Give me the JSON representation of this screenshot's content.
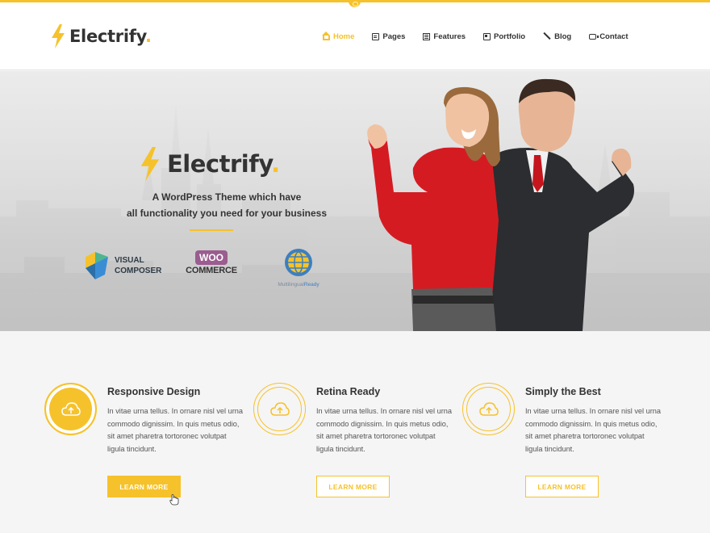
{
  "brand": {
    "name": "Electrify",
    "dot": ".",
    "accent_color": "#f6c22b"
  },
  "nav": {
    "items": [
      {
        "label": "Home",
        "icon": "home-icon",
        "active": true
      },
      {
        "label": "Pages",
        "icon": "pages-icon"
      },
      {
        "label": "Features",
        "icon": "features-icon"
      },
      {
        "label": "Portfolio",
        "icon": "portfolio-icon"
      },
      {
        "label": "Blog",
        "icon": "blog-icon"
      },
      {
        "label": "Contact",
        "icon": "contact-icon"
      }
    ]
  },
  "hero": {
    "logo_text": "Electrify",
    "logo_dot": ".",
    "tagline_line1": "A WordPress Theme which have",
    "tagline_line2": "all functionality you need for your business",
    "partners": {
      "vc_line1": "VISUAL",
      "vc_line2": "COMPOSER",
      "woo_badge": "WOO",
      "woo_text": "COMMERCE",
      "wpml_text": "Multilingual",
      "wpml_ready": "Ready"
    }
  },
  "features": [
    {
      "title": "Responsive Design",
      "text": "In vitae urna tellus. In ornare nisl vel urna commodo dignissim. In quis metus odio, sit amet pharetra tortoronec volutpat ligula tincidunt.",
      "button": "LEARN MORE",
      "icon": "cloud-upload-icon"
    },
    {
      "title": "Retina Ready",
      "text": "In vitae urna tellus. In ornare nisl vel urna commodo dignissim. In quis metus odio, sit amet pharetra tortoronec volutpat ligula tincidunt.",
      "button": "LEARN MORE",
      "icon": "cloud-upload-icon"
    },
    {
      "title": "Simply the Best",
      "text": "In vitae urna tellus. In ornare nisl vel urna commodo dignissim. In quis metus odio, sit amet pharetra tortoronec volutpat ligula tincidunt.",
      "button": "LEARN MORE",
      "icon": "cloud-upload-icon"
    }
  ]
}
